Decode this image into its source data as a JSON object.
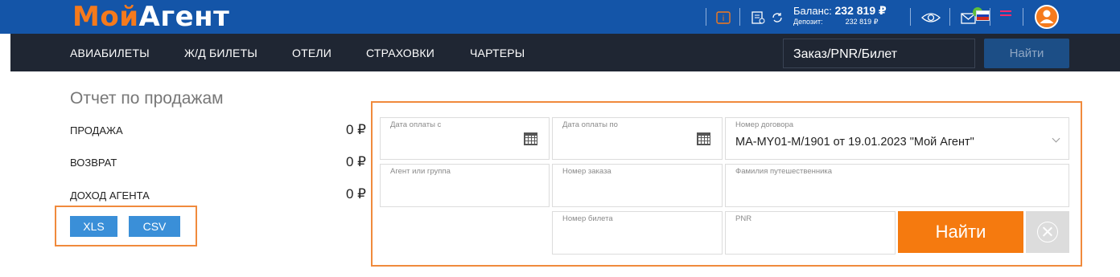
{
  "header": {
    "logo_part1": "Мой",
    "logo_part2": "Агент",
    "balance_label": "Баланс:",
    "balance_value": "232 819 ₽",
    "deposit_label": "Депозит:",
    "deposit_value": "232 819 ₽",
    "brand_orange": "#f57a1c",
    "brand_blue": "#1455a8",
    "icons": [
      "info-icon",
      "receipt-icon",
      "refresh-icon",
      "eye-icon",
      "mail-icon",
      "flag-ru-icon",
      "menu-icon",
      "user-avatar-icon"
    ]
  },
  "nav": {
    "items": [
      "АВИАБИЛЕТЫ",
      "Ж/Д БИЛЕТЫ",
      "ОТЕЛИ",
      "СТРАХОВКИ",
      "ЧАРТЕРЫ"
    ],
    "order_placeholder": "Заказ/PNR/Билет",
    "order_search_label": "Найти"
  },
  "report": {
    "title": "Отчет по продажам",
    "stats": [
      {
        "label": "ПРОДАЖА",
        "value": "0 ₽"
      },
      {
        "label": "ВОЗВРАТ",
        "value": "0 ₽"
      },
      {
        "label": "ДОХОД АГЕНТА",
        "value": "0 ₽"
      }
    ],
    "export_xls": "XLS",
    "export_csv": "CSV"
  },
  "filters": {
    "date_from_label": "Дата оплаты с",
    "date_to_label": "Дата оплаты по",
    "contract_label": "Номер договора",
    "contract_value": "MA-MY01-M/1901 от 19.01.2023 \"Мой Агент\"",
    "agent_label": "Агент или группа",
    "order_label": "Номер заказа",
    "surname_label": "Фамилия путешественника",
    "ticket_label": "Номер билета",
    "pnr_label": "PNR",
    "find_label": "Найти"
  }
}
